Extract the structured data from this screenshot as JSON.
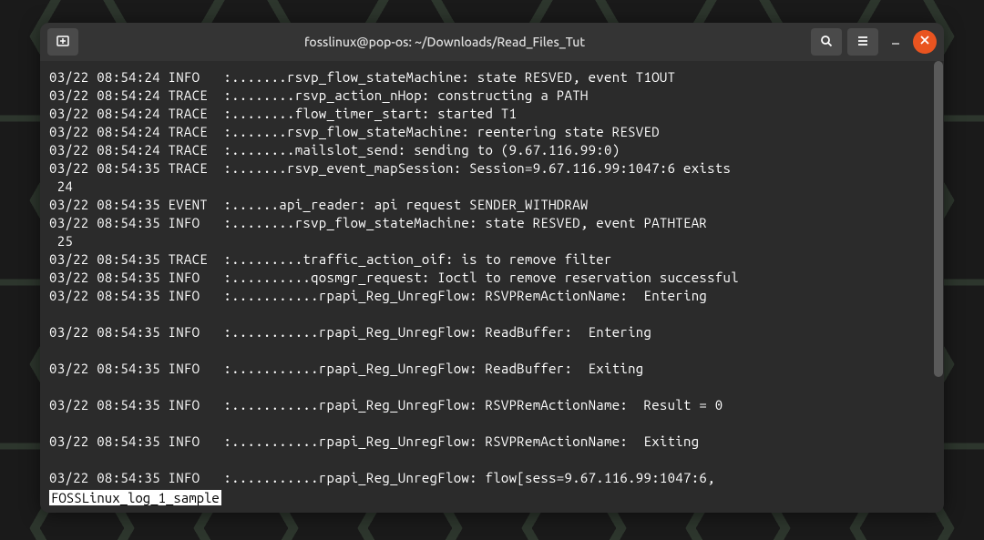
{
  "window": {
    "title": "fosslinux@pop-os: ~/Downloads/Read_Files_Tut"
  },
  "terminal": {
    "lines": [
      "03/22 08:54:24 INFO   :.......rsvp_flow_stateMachine: state RESVED, event T1OUT",
      "03/22 08:54:24 TRACE  :........rsvp_action_nHop: constructing a PATH",
      "03/22 08:54:24 TRACE  :........flow_timer_start: started T1",
      "03/22 08:54:24 TRACE  :.......rsvp_flow_stateMachine: reentering state RESVED",
      "03/22 08:54:24 TRACE  :........mailslot_send: sending to (9.67.116.99:0)",
      "03/22 08:54:35 TRACE  :.......rsvp_event_mapSession: Session=9.67.116.99:1047:6 exists",
      " 24",
      "03/22 08:54:35 EVENT  :......api_reader: api request SENDER_WITHDRAW",
      "03/22 08:54:35 INFO   :........rsvp_flow_stateMachine: state RESVED, event PATHTEAR",
      " 25",
      "03/22 08:54:35 TRACE  :.........traffic_action_oif: is to remove filter",
      "03/22 08:54:35 INFO   :..........qosmgr_request: Ioctl to remove reservation successful",
      "03/22 08:54:35 INFO   :...........rpapi_Reg_UnregFlow: RSVPRemActionName:  Entering",
      "",
      "03/22 08:54:35 INFO   :...........rpapi_Reg_UnregFlow: ReadBuffer:  Entering",
      "",
      "03/22 08:54:35 INFO   :...........rpapi_Reg_UnregFlow: ReadBuffer:  Exiting",
      "",
      "03/22 08:54:35 INFO   :...........rpapi_Reg_UnregFlow: RSVPRemActionName:  Result = 0",
      "",
      "03/22 08:54:35 INFO   :...........rpapi_Reg_UnregFlow: RSVPRemActionName:  Exiting",
      "",
      "03/22 08:54:35 INFO   :...........rpapi_Reg_UnregFlow: flow[sess=9.67.116.99:1047:6,"
    ],
    "status_filename": "FOSSLinux_log_1_sample"
  }
}
